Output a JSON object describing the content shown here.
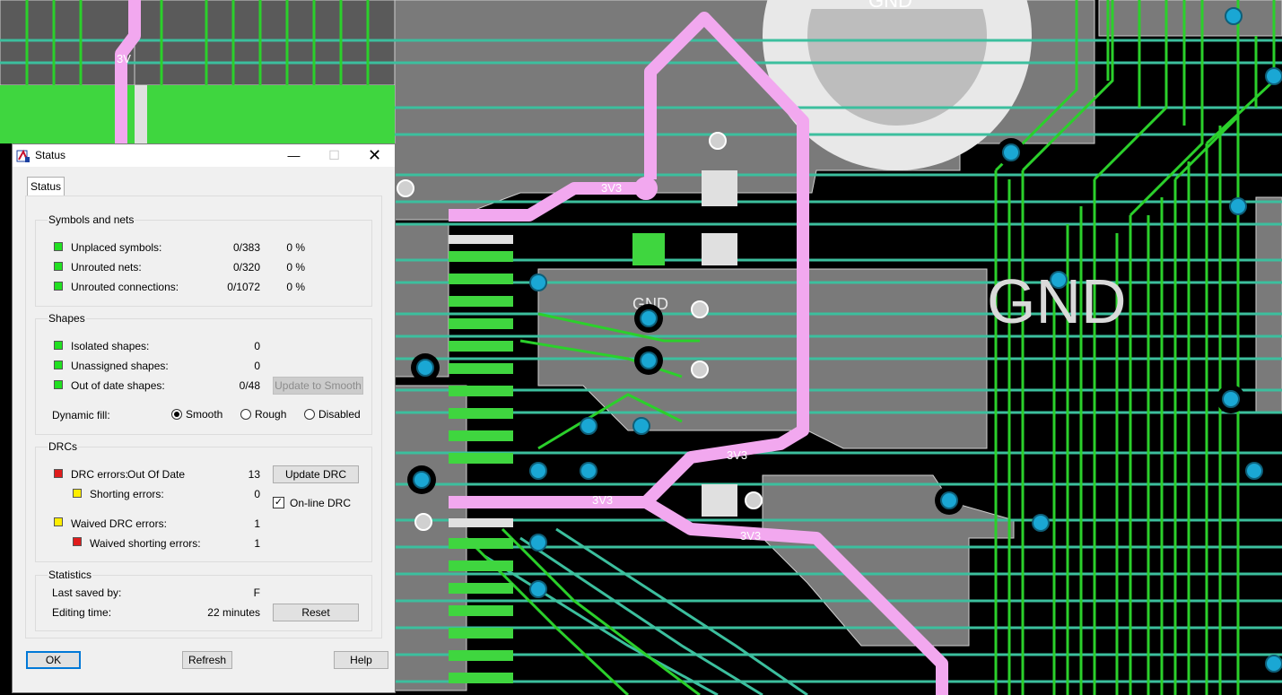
{
  "board": {
    "labels": {
      "gnd_big": "GND",
      "gnd_top": "GND",
      "gnd_small": "GND",
      "v3": "3V3",
      "v3v": "3V"
    },
    "colors": {
      "background": "#000000",
      "copper_pour": "#7a7a7a",
      "trace_green": "#2bd02b",
      "trace_teal": "#3cbf9e",
      "trace_pink": "#f2a8ef",
      "via": "#1aa7d4",
      "pad": "#d8d8d8"
    }
  },
  "dialog": {
    "title": "Status",
    "controls": {
      "minimize": "—",
      "maximize": "☐",
      "close": "✕"
    },
    "tab": "Status",
    "symbols_and_nets": {
      "title": "Symbols and nets",
      "rows": [
        {
          "label": "Unplaced symbols:",
          "count": "0/383",
          "percent": "0 %",
          "status": "green"
        },
        {
          "label": "Unrouted nets:",
          "count": "0/320",
          "percent": "0 %",
          "status": "green"
        },
        {
          "label": "Unrouted connections:",
          "count": "0/1072",
          "percent": "0 %",
          "status": "green"
        }
      ]
    },
    "shapes": {
      "title": "Shapes",
      "rows": [
        {
          "label": "Isolated shapes:",
          "value": "0",
          "status": "green"
        },
        {
          "label": "Unassigned shapes:",
          "value": "0",
          "status": "green"
        },
        {
          "label": "Out of date shapes:",
          "value": "0/48",
          "status": "green"
        }
      ],
      "update_button": "Update to Smooth",
      "dynamic_fill_label": "Dynamic fill:",
      "fill_options": [
        "Smooth",
        "Rough",
        "Disabled"
      ],
      "fill_selected": "Smooth"
    },
    "drcs": {
      "title": "DRCs",
      "drc_errors_label": "DRC errors:",
      "drc_state": "Out Of Date",
      "drc_errors_value": "13",
      "shorting_label": "Shorting errors:",
      "shorting_value": "0",
      "waived_label": "Waived DRC errors:",
      "waived_value": "1",
      "waived_shorting_label": "Waived shorting errors:",
      "waived_shorting_value": "1",
      "update_button": "Update DRC",
      "online_label": "On-line DRC",
      "online_checked": true
    },
    "statistics": {
      "title": "Statistics",
      "last_saved_label": "Last saved by:",
      "last_saved_value": "F",
      "editing_label": "Editing time:",
      "editing_value": "22 minutes",
      "reset_button": "Reset"
    },
    "buttons": {
      "ok": "OK",
      "refresh": "Refresh",
      "help": "Help"
    }
  }
}
